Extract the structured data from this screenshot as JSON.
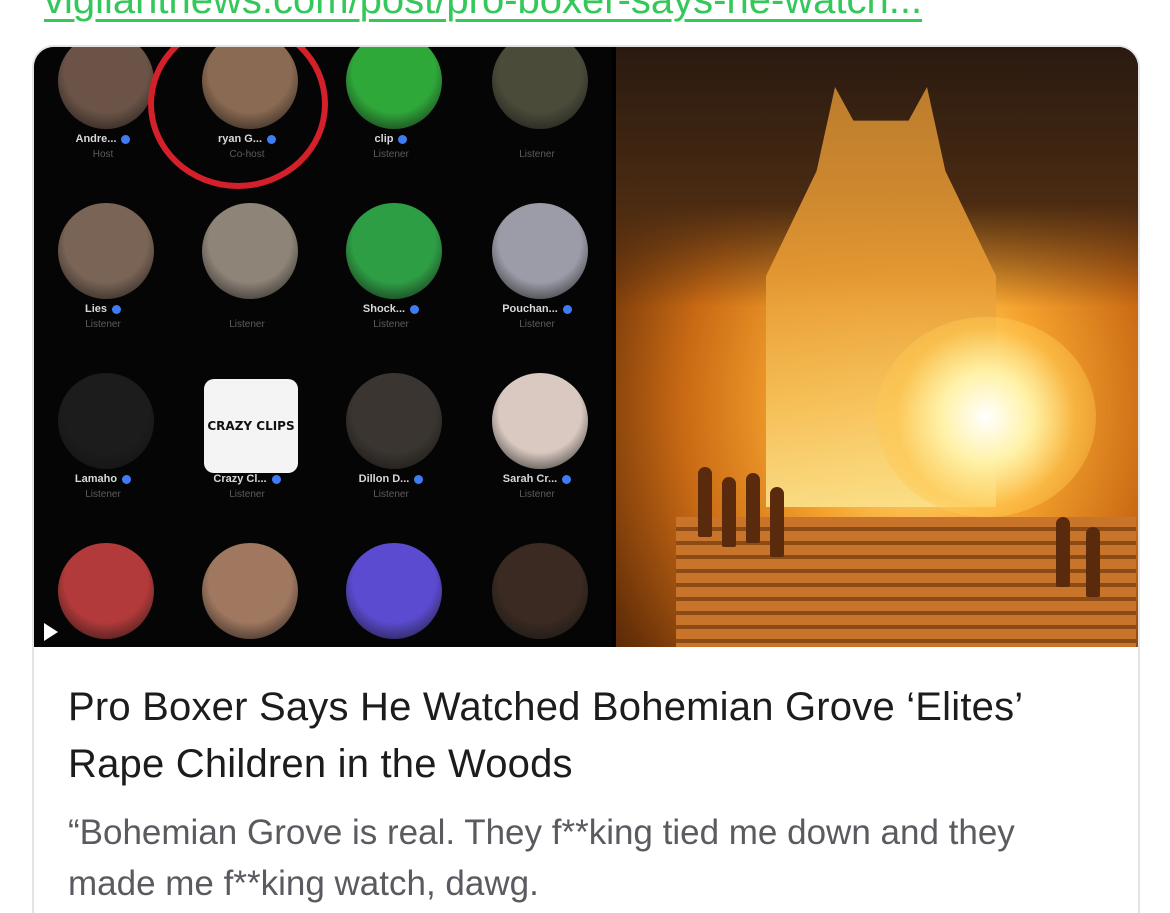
{
  "link": {
    "url_text": "vigilantnews.com/post/pro-boxer-says-he-watch..."
  },
  "card": {
    "title": "Pro Boxer Says He Watched Bohemian Grove ‘Elites’ Rape Children in the Woods",
    "description": "“Bohemian Grove is real. They f**king tied me down and they made me f**king watch, dawg."
  },
  "preview": {
    "grid_tiles": [
      {
        "name": "Andre...",
        "role": "Host",
        "avatar_color": "#6b5447"
      },
      {
        "name": "ryan G...",
        "role": "Co-host",
        "avatar_color": "#8a6a52"
      },
      {
        "name": "clip",
        "role": "Listener",
        "avatar_color": "#2fa83a"
      },
      {
        "name": "",
        "role": "Listener",
        "avatar_color": "#4b4b3a"
      },
      {
        "name": "Lies",
        "role": "Listener",
        "avatar_color": "#7a6456"
      },
      {
        "name": "",
        "role": "Listener",
        "avatar_color": "#8e8478"
      },
      {
        "name": "Shock...",
        "role": "Listener",
        "avatar_color": "#2e9e45"
      },
      {
        "name": "Pouchan...",
        "role": "Listener",
        "avatar_color": "#9c9ca8"
      },
      {
        "name": "Lamaho",
        "role": "Listener",
        "avatar_color": "#1c1c1c"
      },
      {
        "name": "Crazy Cl...",
        "role": "Listener",
        "avatar_color": "#f4f4f4",
        "square_text": "CRAZY CLIPS"
      },
      {
        "name": "Dillon D...",
        "role": "Listener",
        "avatar_color": "#3a3530"
      },
      {
        "name": "Sarah Cr...",
        "role": "Listener",
        "avatar_color": "#d9c9c0"
      },
      {
        "name": "",
        "role": "",
        "avatar_color": "#b33a3a"
      },
      {
        "name": "",
        "role": "",
        "avatar_color": "#a07860"
      },
      {
        "name": "",
        "role": "",
        "avatar_color": "#5b4bd0"
      },
      {
        "name": "",
        "role": "",
        "avatar_color": "#3a2a22"
      }
    ]
  }
}
